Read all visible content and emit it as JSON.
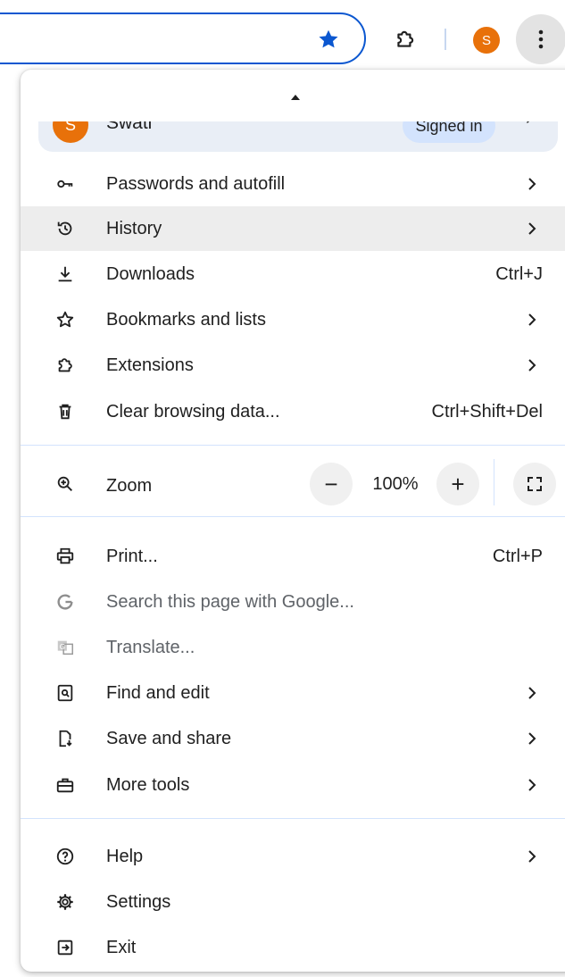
{
  "toolbar": {
    "profile_initial": "S"
  },
  "profile": {
    "initial": "S",
    "name": "Swati",
    "status": "Signed in"
  },
  "menu": {
    "group1": [
      {
        "id": "passwords",
        "label": "Passwords and autofill",
        "shortcut": "",
        "icon": "key-icon",
        "submenu": true
      },
      {
        "id": "history",
        "label": "History",
        "shortcut": "",
        "icon": "history-icon",
        "submenu": true,
        "hovered": true
      },
      {
        "id": "downloads",
        "label": "Downloads",
        "shortcut": "Ctrl+J",
        "icon": "download-icon",
        "submenu": false
      },
      {
        "id": "bookmarks",
        "label": "Bookmarks and lists",
        "shortcut": "",
        "icon": "star-outline-icon",
        "submenu": true
      },
      {
        "id": "extensions",
        "label": "Extensions",
        "shortcut": "",
        "icon": "puzzle-icon",
        "submenu": true
      },
      {
        "id": "clear-data",
        "label": "Clear browsing data...",
        "shortcut": "Ctrl+Shift+Del",
        "icon": "trash-icon",
        "submenu": false
      }
    ],
    "zoom": {
      "label": "Zoom",
      "minus": "−",
      "plus": "+",
      "value": "100%"
    },
    "group2": [
      {
        "id": "print",
        "label": "Print...",
        "shortcut": "Ctrl+P",
        "icon": "printer-icon",
        "submenu": false
      },
      {
        "id": "search-google",
        "label": "Search this page with Google...",
        "shortcut": "",
        "icon": "google-g-icon",
        "submenu": false,
        "dim": true
      },
      {
        "id": "translate",
        "label": "Translate...",
        "shortcut": "",
        "icon": "translate-icon",
        "submenu": false,
        "dim": true
      },
      {
        "id": "find-edit",
        "label": "Find and edit",
        "shortcut": "",
        "icon": "find-page-icon",
        "submenu": true
      },
      {
        "id": "save-share",
        "label": "Save and share",
        "shortcut": "",
        "icon": "save-page-icon",
        "submenu": true
      },
      {
        "id": "more-tools",
        "label": "More tools",
        "shortcut": "",
        "icon": "toolbox-icon",
        "submenu": true
      }
    ],
    "group3": [
      {
        "id": "help",
        "label": "Help",
        "shortcut": "",
        "icon": "help-icon",
        "submenu": true
      },
      {
        "id": "settings",
        "label": "Settings",
        "shortcut": "",
        "icon": "gear-icon",
        "submenu": false
      },
      {
        "id": "exit",
        "label": "Exit",
        "shortcut": "",
        "icon": "exit-icon",
        "submenu": false
      }
    ]
  },
  "colors": {
    "accent": "#0b57d0",
    "avatar": "#e8710a",
    "hover": "#ededed",
    "badge": "#d3e3fd",
    "profile_bg": "#e9eef6"
  }
}
